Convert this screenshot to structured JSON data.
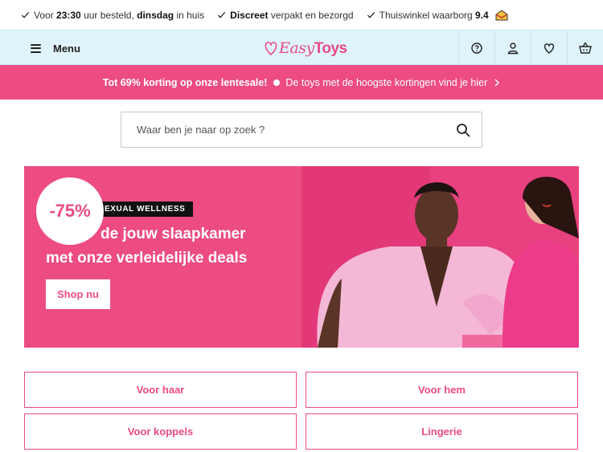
{
  "usp": {
    "items": [
      {
        "parts": [
          "Voor ",
          "23:30",
          " uur besteld, ",
          "dinsdag",
          " in huis"
        ]
      },
      {
        "parts": [
          "",
          "Discreet",
          " verpakt en bezorgd"
        ]
      },
      {
        "parts": [
          "Thuiswinkel waarborg ",
          "9.4"
        ]
      }
    ]
  },
  "header": {
    "menu_label": "Menu",
    "logo": {
      "part1": "Easy",
      "part2": "Toys"
    },
    "icons": [
      "help-icon",
      "account-icon",
      "wishlist-icon",
      "cart-icon"
    ]
  },
  "promo": {
    "bold": "Tot 69% korting op onze lentesale!",
    "text": "De toys met de hoogste kortingen vind je hier"
  },
  "search": {
    "placeholder": "Waar ben je naar op zoek ?"
  },
  "hero": {
    "tag": "EXUAL WELLNESS",
    "title_line1": "de jouw slaapkamer",
    "title_line2": "met onze verleidelijke deals",
    "button": "Shop nu",
    "discount": "-75%"
  },
  "categories": [
    {
      "label": "Voor haar"
    },
    {
      "label": "Voor hem"
    },
    {
      "label": "Voor koppels"
    },
    {
      "label": "Lingerie"
    }
  ],
  "colors": {
    "brand_pink": "#ec4c82",
    "header_bg": "#dff3fa"
  }
}
